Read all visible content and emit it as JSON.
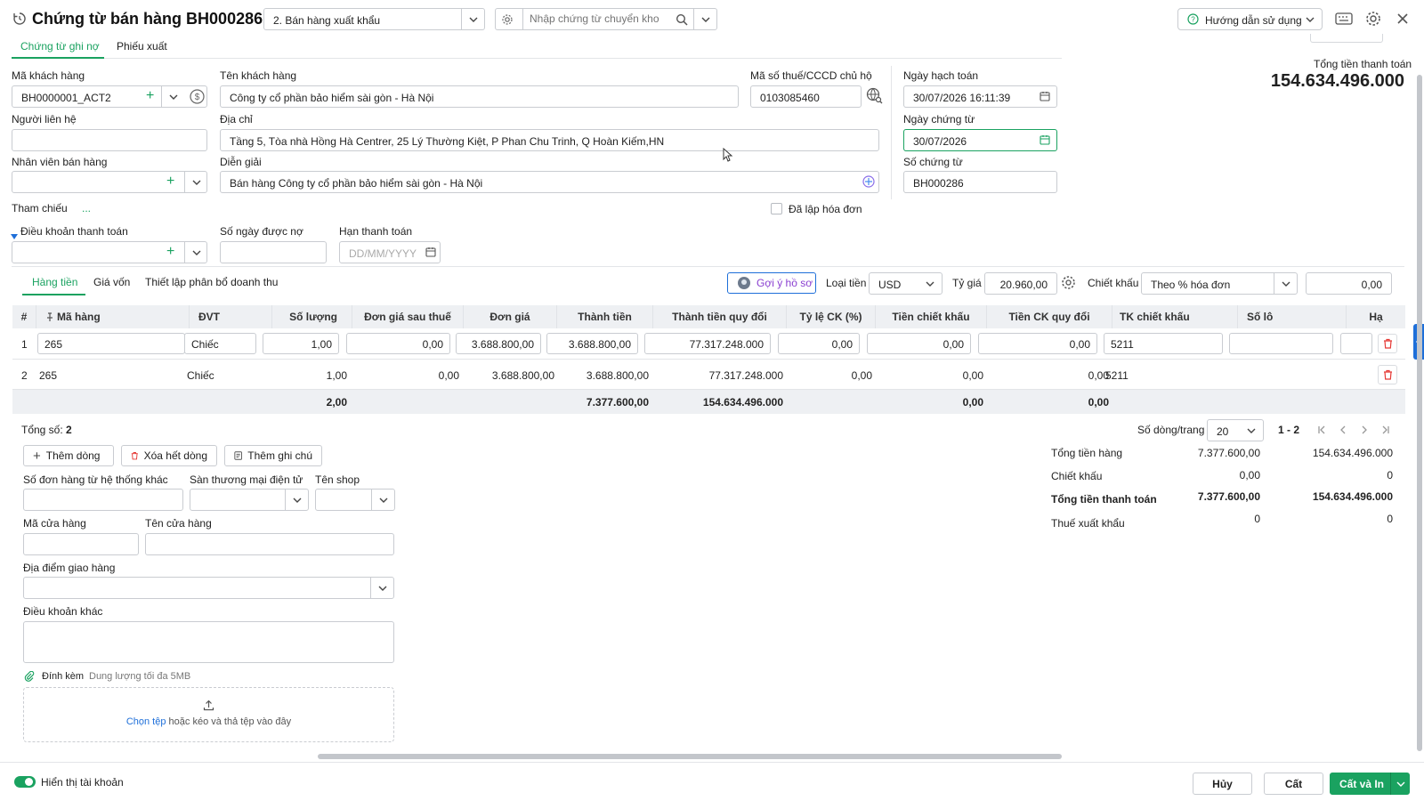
{
  "header": {
    "title": "Chứng từ bán hàng BH000286",
    "voucher_type": "2. Bán hàng xuất khẩu",
    "search_placeholder": "Nhập chứng từ chuyển kho",
    "help_label": "Hướng dẫn sử dụng"
  },
  "tabs": [
    "Chứng từ ghi nợ",
    "Phiếu xuất"
  ],
  "total": {
    "label": "Tổng tiền thanh toán",
    "value": "154.634.496.000"
  },
  "customer": {
    "code_label": "Mã khách hàng",
    "code": "BH0000001_ACT2",
    "name_label": "Tên khách hàng",
    "name": "Công ty cổ phần bảo hiểm sài gòn - Hà Nội",
    "tax_label": "Mã số thuế/CCCD chủ hộ",
    "tax": "0103085460",
    "contact_label": "Người liên hệ",
    "address_label": "Địa chỉ",
    "address": "Tầng 5, Tòa nhà Hồng Hà Centrer, 25 Lý Thường Kiệt, P Phan Chu Trinh, Q Hoàn Kiếm,HN",
    "salesperson_label": "Nhân viên bán hàng",
    "description_label": "Diễn giải",
    "description": "Bán hàng Công ty cổ phần bảo hiểm sài gòn - Hà Nội",
    "reference_label": "Tham chiếu",
    "reference_value": "...",
    "invoiced_label": "Đã lập hóa đơn"
  },
  "dates": {
    "posting_label": "Ngày hạch toán",
    "posting": "30/07/2026 16:11:39",
    "voucher_date_label": "Ngày chứng từ",
    "voucher_date": "30/07/2026",
    "voucher_no_label": "Số chứng từ",
    "voucher_no": "BH000286"
  },
  "payment": {
    "terms_label": "Điều khoản thanh toán",
    "days_label": "Số ngày được nợ",
    "due_label": "Hạn thanh toán",
    "due_placeholder": "DD/MM/YYYY"
  },
  "grid_tabs": [
    "Hàng tiền",
    "Giá vốn",
    "Thiết lập phân bổ doanh thu"
  ],
  "toolbar": {
    "suggest": "Gợi ý hồ sơ",
    "currency_label": "Loại tiền",
    "currency": "USD",
    "rate_label": "Tỷ giá",
    "rate": "20.960,00",
    "discount_label": "Chiết khấu",
    "discount_mode": "Theo % hóa đơn",
    "discount_value": "0,00"
  },
  "columns": [
    "#",
    "Mã hàng",
    "ĐVT",
    "Số lượng",
    "Đơn giá sau thuế",
    "Đơn giá",
    "Thành tiền",
    "Thành tiền quy đổi",
    "Tỷ lệ CK (%)",
    "Tiền chiết khấu",
    "Tiền CK quy đổi",
    "TK chiết khấu",
    "Số lô",
    "Hạ"
  ],
  "rows": [
    {
      "no": "1",
      "code": "265",
      "unit": "Chiếc",
      "qty": "1,00",
      "price_tax": "0,00",
      "price": "3.688.800,00",
      "amount": "3.688.800,00",
      "amount_conv": "77.317.248.000",
      "ck_rate": "0,00",
      "ck": "0,00",
      "ck_conv": "0,00",
      "ck_acc": "5211",
      "lot": ""
    },
    {
      "no": "2",
      "code": "265",
      "unit": "Chiếc",
      "qty": "1,00",
      "price_tax": "0,00",
      "price": "3.688.800,00",
      "amount": "3.688.800,00",
      "amount_conv": "77.317.248.000",
      "ck_rate": "0,00",
      "ck": "0,00",
      "ck_conv": "0,00",
      "ck_acc": "5211",
      "lot": ""
    }
  ],
  "totals_row": {
    "qty": "2,00",
    "amount": "7.377.600,00",
    "amount_conv": "154.634.496.000",
    "ck": "0,00",
    "ck_conv": "0,00"
  },
  "pager": {
    "count_label": "Tổng số:",
    "count": "2",
    "per_page_label": "Số dòng/trang",
    "per_page": "20",
    "range": "1 - 2"
  },
  "actions": {
    "add_row": "Thêm dòng",
    "delete_all": "Xóa hết dòng",
    "add_note": "Thêm ghi chú"
  },
  "extra": {
    "other_order_label": "Số đơn hàng từ hệ thống khác",
    "marketplace_label": "Sàn thương mại điện tử",
    "shop_label": "Tên shop",
    "store_code_label": "Mã cửa hàng",
    "store_name_label": "Tên cửa hàng",
    "delivery_label": "Địa điểm giao hàng",
    "other_terms_label": "Điều khoản khác",
    "attach_label": "Đính kèm",
    "attach_hint": "Dung lượng tối đa 5MB",
    "upload_link": "Chọn tệp",
    "upload_text": "hoặc kéo và thả tệp vào đây"
  },
  "summary": [
    {
      "label": "Tổng tiền hàng",
      "v1": "7.377.600,00",
      "v2": "154.634.496.000",
      "bold": false
    },
    {
      "label": "Chiết khấu",
      "v1": "0,00",
      "v2": "0",
      "bold": false
    },
    {
      "label": "Tổng tiền thanh toán",
      "v1": "7.377.600,00",
      "v2": "154.634.496.000",
      "bold": true
    },
    {
      "label": "Thuế xuất khẩu",
      "v1": "0",
      "v2": "0",
      "bold": false
    }
  ],
  "footer": {
    "show_accounts": "Hiển thị tài khoản",
    "cancel": "Hủy",
    "save": "Cất",
    "save_print": "Cất và In"
  },
  "colors": {
    "accent": "#1aa260",
    "danger": "#e53935",
    "link": "#1e6fd9"
  }
}
